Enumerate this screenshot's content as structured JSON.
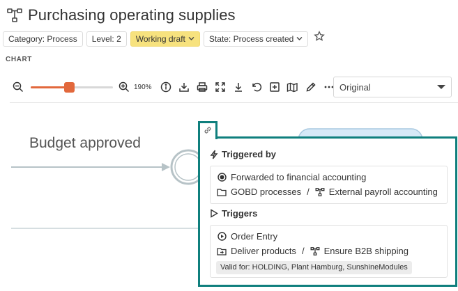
{
  "header": {
    "title": "Purchasing operating supplies",
    "title_icon": "process-flow-icon"
  },
  "tags": {
    "category": "Category: Process",
    "level": "Level: 2",
    "status": "Working draft",
    "state": "State: Process created"
  },
  "section": {
    "label": "CHART"
  },
  "toolbar": {
    "zoom_value": "190%",
    "zoom_fraction": 0.47,
    "view_select": "Original",
    "icons": [
      "zoom-out-icon",
      "zoom-in-icon",
      "info-icon",
      "download-icon",
      "print-icon",
      "fit-screen-icon",
      "align-bottom-icon",
      "undo-icon",
      "add-box-icon",
      "map-icon",
      "edit-pencil-icon",
      "more-icon"
    ]
  },
  "diagram": {
    "event_label": "Budget approved"
  },
  "popover": {
    "triggered_by": {
      "heading": "Triggered by",
      "item": "Forwarded to financial accounting",
      "path_folder": "GOBD processes",
      "path_separator": "/",
      "path_process": "External payroll accounting"
    },
    "triggers": {
      "heading": "Triggers",
      "item": "Order Entry",
      "path_folder": "Deliver products",
      "path_separator": "/",
      "path_process": "Ensure B2B shipping",
      "valid_for": "Valid for: HOLDING, Plant Hamburg, SunshineModules"
    }
  },
  "colors": {
    "accent_teal": "#0f7f7d",
    "slider_orange": "#e2683c",
    "draft_yellow": "#f7e27e",
    "process_blue": "#d6e9f7"
  }
}
